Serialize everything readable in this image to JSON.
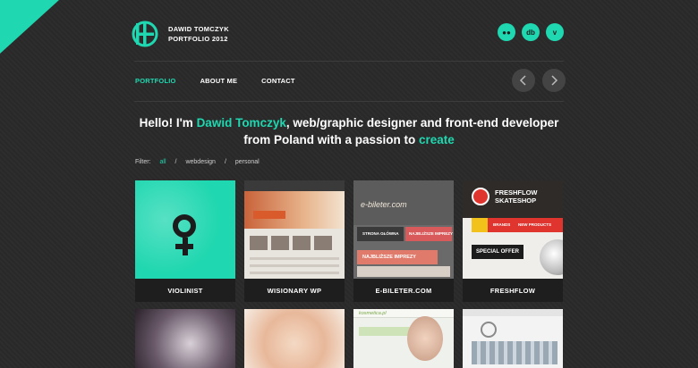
{
  "header": {
    "name": "DAWID TOMCZYK",
    "subtitle": "PORTFOLIO 2012",
    "socials": [
      {
        "icon": "flickr-icon",
        "glyph": "●●"
      },
      {
        "icon": "dribbble-icon",
        "glyph": "db"
      },
      {
        "icon": "vimeo-icon",
        "glyph": "v"
      }
    ]
  },
  "nav": {
    "items": [
      "PORTFOLIO",
      "ABOUT ME",
      "CONTACT"
    ],
    "active": "PORTFOLIO"
  },
  "headline": {
    "part1": "Hello! I'm ",
    "name": "Dawid Tomczyk",
    "part2": ", web/graphic designer  and front-end developer",
    "part3": "from Poland with a passion to ",
    "accent2": "create"
  },
  "filter": {
    "label": "Filter:",
    "options": [
      "all",
      "webdesign",
      "personal"
    ],
    "active": "all",
    "separator": "/"
  },
  "projects": [
    {
      "title": "VIOLINIST"
    },
    {
      "title": "WISIONARY WP"
    },
    {
      "title": "E-BILETER.COM"
    },
    {
      "title": "FRESHFLOW"
    }
  ],
  "thumb_text": {
    "ebileter_logo": "e-bileter.com",
    "ebileter_nav_left": "STRONA GŁÓWNA",
    "ebileter_nav_right": "NAJBLIŻSZE IMPREZY",
    "ebileter_banner": "NAJBLIŻSZE IMPREZY",
    "freshflow_brand_1": "FRESHFLOW",
    "freshflow_brand_2": "SKATESHOP",
    "freshflow_menu_1": "BRANDS",
    "freshflow_menu_2": "NEW PRODUCTS",
    "freshflow_offer": "SPECIAL OFFER",
    "row2_site": "kosmetica.pl"
  },
  "colors": {
    "accent": "#1fd7b0",
    "background": "#2a2a2a",
    "caption_bg": "#1e1e1e"
  }
}
